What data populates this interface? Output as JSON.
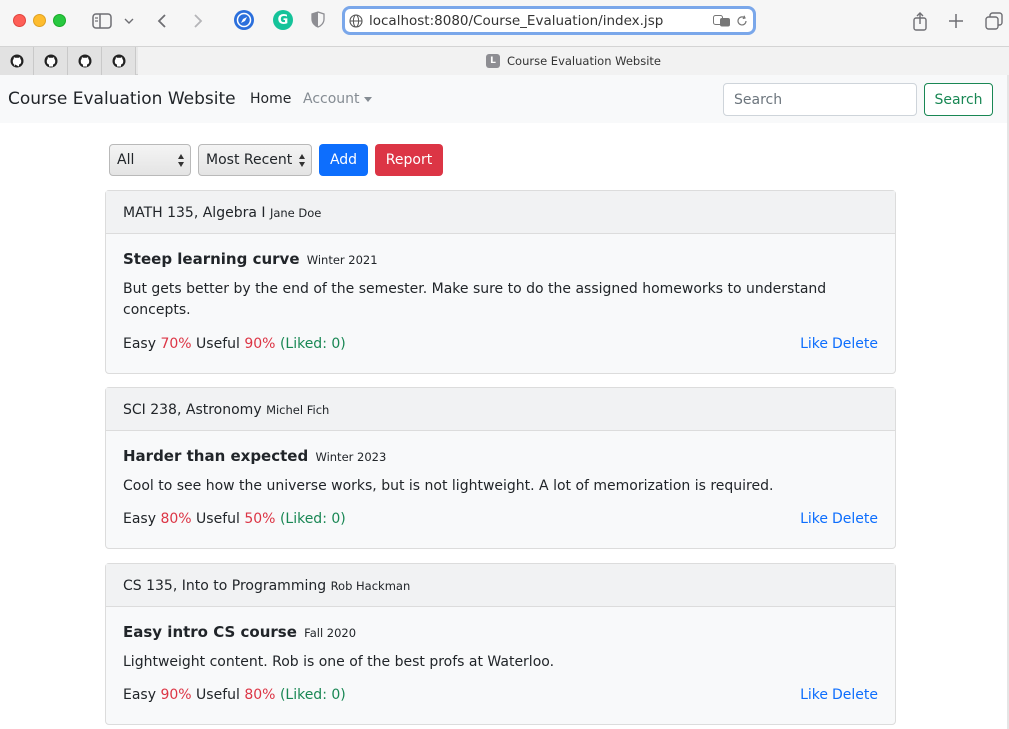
{
  "browser": {
    "url": "localhost:8080/Course_Evaluation/index.jsp",
    "tab_title": "Course Evaluation Website",
    "tab_favicon_letter": "L",
    "extension_g": "G"
  },
  "navbar": {
    "brand": "Course Evaluation Website",
    "home": "Home",
    "account": "Account",
    "search_placeholder": "Search",
    "search_button": "Search"
  },
  "controls": {
    "category_select": "All",
    "sort_select": "Most Recent",
    "add_button": "Add",
    "report_button": "Report"
  },
  "labels": {
    "easy": "Easy",
    "useful": "Useful",
    "like": "Like",
    "delete": "Delete"
  },
  "evaluations": [
    {
      "course": "MATH 135, Algebra I",
      "professor": "Jane Doe",
      "title": "Steep learning curve",
      "term": "Winter 2021",
      "content": "But gets better by the end of the semester. Make sure to do the assigned homeworks to understand concepts.",
      "easy": "70%",
      "useful": "90%",
      "liked": "(Liked: 0)"
    },
    {
      "course": "SCI 238, Astronomy",
      "professor": "Michel Fich",
      "title": "Harder than expected",
      "term": "Winter 2023",
      "content": "Cool to see how the universe works, but is not lightweight. A lot of memorization is required.",
      "easy": "80%",
      "useful": "50%",
      "liked": "(Liked: 0)"
    },
    {
      "course": "CS 135, Into to Programming",
      "professor": "Rob Hackman",
      "title": "Easy intro CS course",
      "term": "Fall 2020",
      "content": "Lightweight content. Rob is one of the best profs at Waterloo.",
      "easy": "90%",
      "useful": "80%",
      "liked": "(Liked: 0)"
    }
  ]
}
